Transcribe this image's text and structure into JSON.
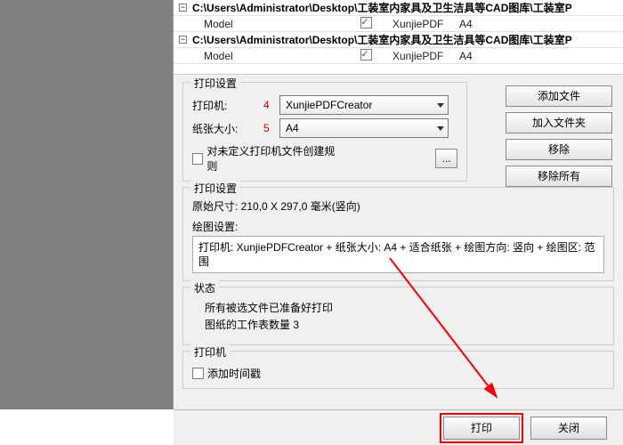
{
  "tree": {
    "path1": "C:\\Users\\Administrator\\Desktop\\工装室内家具及卫生洁具等CAD图库\\工装室P",
    "model_label": "Model",
    "pdf_label": "XunjiePDF",
    "paper_label": "A4",
    "path2": "C:\\Users\\Administrator\\Desktop\\工装室内家具及卫生洁具等CAD图库\\工装室P"
  },
  "print_settings": {
    "group_label": "打印设置",
    "printer_label": "打印机:",
    "printer_value": "XunjiePDFCreator",
    "paper_label": "纸张大小:",
    "paper_value": "A4",
    "rule_checkbox_label": "对未定义打印机文件创建规则",
    "idx4": "4",
    "idx5": "5",
    "browse_label": "..."
  },
  "side_buttons": {
    "add_file": "添加文件",
    "add_folder": "加入文件夹",
    "remove": "移除",
    "remove_all": "移除所有"
  },
  "print_box": {
    "group_label": "打印设置",
    "original": "原始尺寸: 210,0 X 297,0 毫米(竖向)",
    "draw_label": "绘图设置:",
    "draw_value": "打印机: XunjiePDFCreator + 纸张大小: A4 + 适合纸张 + 绘图方向: 竖向 + 绘图区: 范围"
  },
  "status": {
    "group_label": "状态",
    "line1": "所有被选文件已准备好打印",
    "line2": "图纸的工作表数量 3"
  },
  "printer_group": {
    "group_label": "打印机",
    "checkbox_label": "添加时间戳"
  },
  "bottom": {
    "print": "打印",
    "close": "关闭"
  }
}
